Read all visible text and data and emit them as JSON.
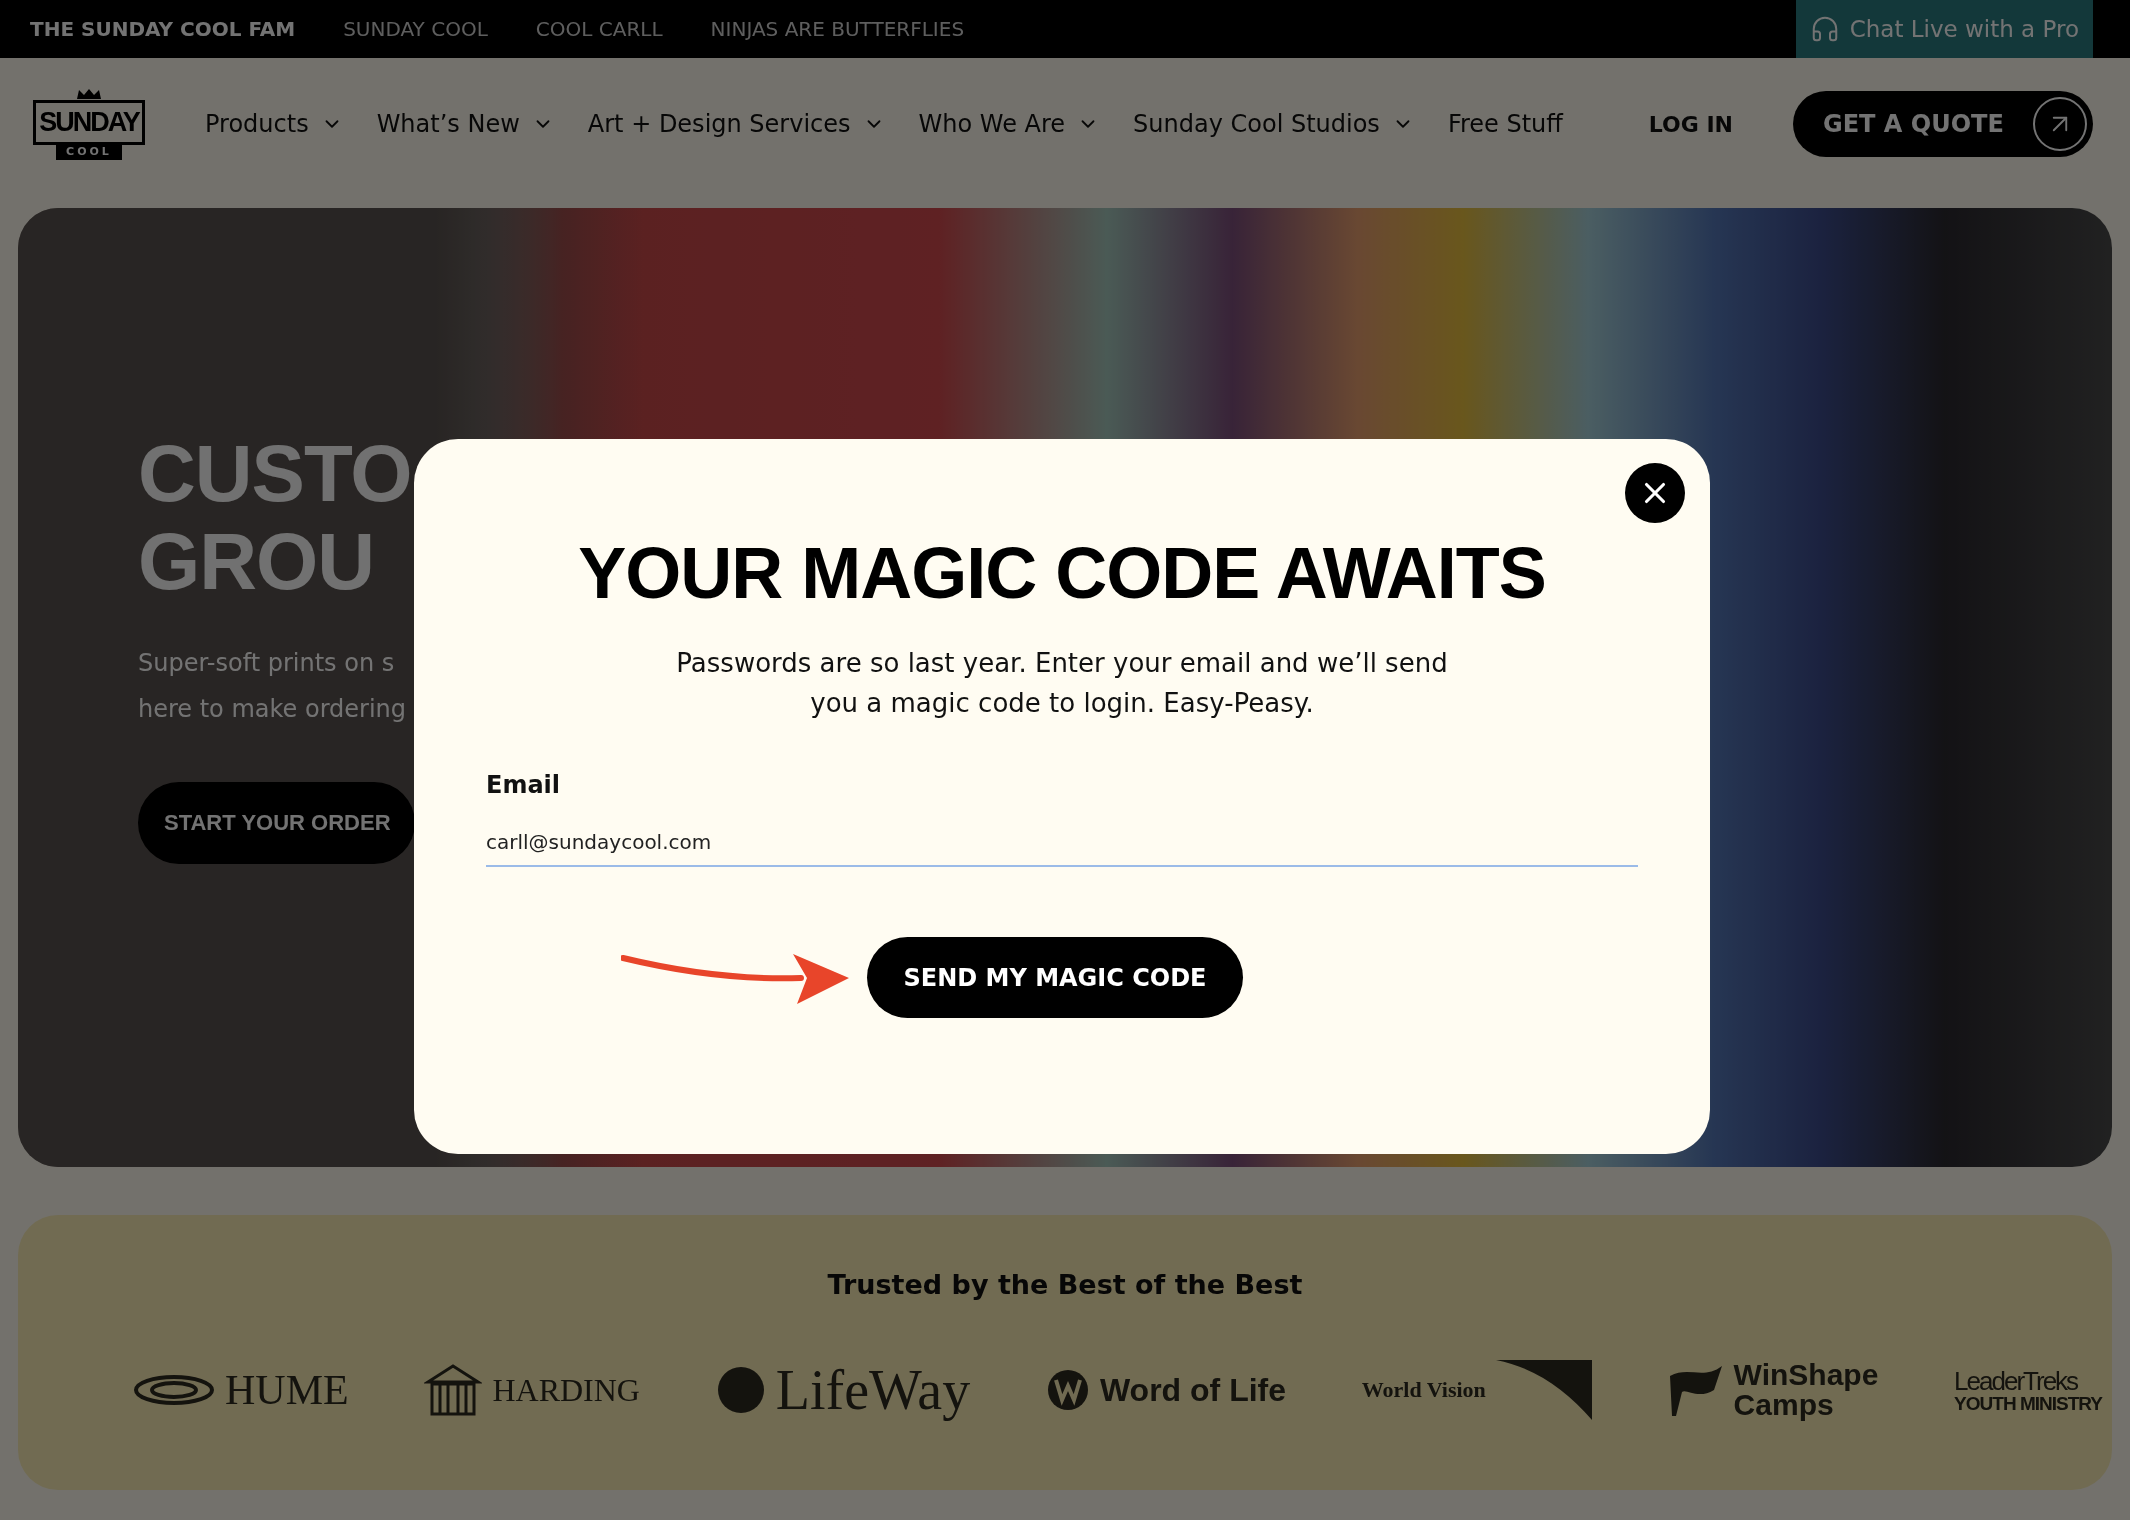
{
  "top_bar": {
    "links": [
      {
        "label": "THE SUNDAY COOL FAM",
        "selected": true
      },
      {
        "label": "SUNDAY COOL",
        "selected": false
      },
      {
        "label": "COOL CARLL",
        "selected": false
      },
      {
        "label": "NINJAS ARE BUTTERFLIES",
        "selected": false
      }
    ],
    "chat_button": "Chat Live with a Pro"
  },
  "logo": {
    "wordmark": "SUNDAY",
    "tag": "COOL"
  },
  "nav": {
    "items": [
      {
        "label": "Products",
        "has_menu": true
      },
      {
        "label": "What’s New",
        "has_menu": true
      },
      {
        "label": "Art + Design Services",
        "has_menu": true
      },
      {
        "label": "Who We Are",
        "has_menu": true
      },
      {
        "label": "Sunday Cool Studios",
        "has_menu": true
      },
      {
        "label": "Free Stuff",
        "has_menu": false
      }
    ],
    "login": "LOG IN",
    "quote_button": "GET A QUOTE"
  },
  "hero": {
    "title_lines": [
      "CUSTO",
      "GROU"
    ],
    "subtitle_lines": [
      "Super-soft prints on s",
      "here to make ordering"
    ],
    "cta": "START YOUR ORDER"
  },
  "modal": {
    "title": "YOUR MAGIC CODE AWAITS",
    "description": "Passwords are so last year. Enter your email and we’ll send you a magic code to login. Easy-Peasy.",
    "email_label": "Email",
    "email_value": "carll@sundaycool.com",
    "submit": "SEND MY MAGIC CODE"
  },
  "trusted": {
    "title": "Trusted by the Best of the Best",
    "logos": [
      {
        "kind": "hume",
        "lines": [
          "HUME"
        ]
      },
      {
        "kind": "harding",
        "lines": [
          "HARDING"
        ]
      },
      {
        "kind": "lifeway",
        "lines": [
          "LifeWay"
        ]
      },
      {
        "kind": "wordoflife",
        "lines": [
          "Word of Life"
        ]
      },
      {
        "kind": "worldvision",
        "lines": [
          "World Vision"
        ]
      },
      {
        "kind": "winshape",
        "lines": [
          "WinShape",
          "Camps"
        ]
      },
      {
        "kind": "leadertreks",
        "lines": [
          "LeaderTreks",
          "YOUTH MINISTRY"
        ]
      }
    ]
  }
}
